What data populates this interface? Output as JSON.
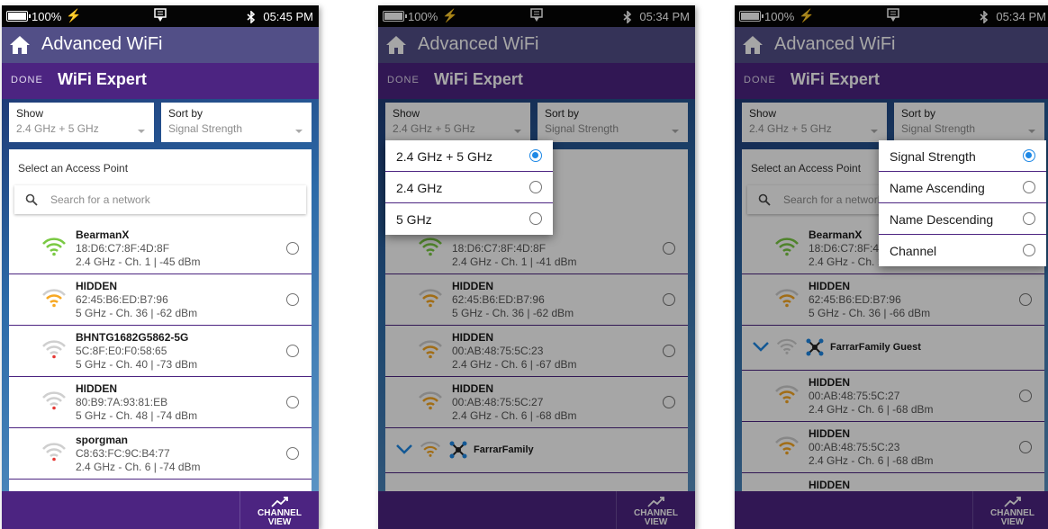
{
  "colors": {
    "header": "#524f87",
    "subheader": "#4c2481",
    "accent": "#1e88e5"
  },
  "panels": [
    {
      "status": {
        "battery": "100%",
        "time": "05:45 PM"
      },
      "app_title": "Advanced WiFi",
      "done": "DONE",
      "expert_title": "WiFi Expert",
      "show": {
        "label": "Show",
        "value": "2.4 GHz + 5 GHz"
      },
      "sort": {
        "label": "Sort by",
        "value": "Signal Strength"
      },
      "list_heading": "Select an Access Point",
      "search_placeholder": "Search for a network",
      "networks": [
        {
          "name": "BearmanX",
          "mac": "18:D6:C7:8F:4D:8F",
          "info": "2.4 GHz - Ch. 1 | -45 dBm",
          "signal": "green"
        },
        {
          "name": "HIDDEN",
          "mac": "62:45:B6:ED:B7:96",
          "info": "5 GHz - Ch. 36 | -62 dBm",
          "signal": "orange"
        },
        {
          "name": "BHNTG1682G5862-5G",
          "mac": "5C:8F:E0:F0:58:65",
          "info": "5 GHz - Ch. 40 | -73 dBm",
          "signal": "red"
        },
        {
          "name": "HIDDEN",
          "mac": "80:B9:7A:93:81:EB",
          "info": "5 GHz - Ch. 48 | -74 dBm",
          "signal": "red"
        },
        {
          "name": "sporgman",
          "mac": "C8:63:FC:9C:B4:77",
          "info": "2.4 GHz - Ch. 6 | -74 dBm",
          "signal": "red"
        }
      ],
      "channel_view": [
        "CHANNEL",
        "VIEW"
      ]
    },
    {
      "status": {
        "battery": "100%",
        "time": "05:34 PM"
      },
      "app_title": "Advanced WiFi",
      "done": "DONE",
      "expert_title": "WiFi Expert",
      "show": {
        "label": "Show",
        "value": "2.4 GHz + 5 GHz"
      },
      "sort": {
        "label": "Sort by",
        "value": "Signal Strength"
      },
      "networks": [
        {
          "name": "",
          "mac": "18:D6:C7:8F:4D:8F",
          "info": "2.4 GHz - Ch. 1 | -41 dBm",
          "signal": "green"
        },
        {
          "name": "HIDDEN",
          "mac": "62:45:B6:ED:B7:96",
          "info": "5 GHz - Ch. 36 | -62 dBm",
          "signal": "orange"
        },
        {
          "name": "HIDDEN",
          "mac": "00:AB:48:75:5C:23",
          "info": "2.4 GHz - Ch. 6 | -67 dBm",
          "signal": "orange"
        },
        {
          "name": "HIDDEN",
          "mac": "00:AB:48:75:5C:27",
          "info": "2.4 GHz - Ch. 6 | -68 dBm",
          "signal": "orange"
        }
      ],
      "group": "FarrarFamily",
      "popup": {
        "options": [
          "2.4 GHz + 5 GHz",
          "2.4 GHz",
          "5 GHz"
        ],
        "selected": 0
      },
      "channel_view": [
        "CHANNEL",
        "VIEW"
      ]
    },
    {
      "status": {
        "battery": "100%",
        "time": "05:34 PM"
      },
      "app_title": "Advanced WiFi",
      "done": "DONE",
      "expert_title": "WiFi Expert",
      "show": {
        "label": "Show",
        "value": "2.4 GHz + 5 GHz"
      },
      "sort": {
        "label": "Sort by",
        "value": "Signal Strength"
      },
      "list_heading": "Select an Access Point",
      "search_placeholder": "Search for a network",
      "networks_a": [
        {
          "name": "BearmanX",
          "mac": "18:D6:C7:8F:4D",
          "info": "2.4 GHz - Ch. 1",
          "signal": "green"
        },
        {
          "name": "HIDDEN",
          "mac": "62:45:B6:ED:B7:96",
          "info": "5 GHz - Ch. 36 | -66 dBm",
          "signal": "orange"
        }
      ],
      "group": "FarrarFamily Guest",
      "networks_b": [
        {
          "name": "HIDDEN",
          "mac": "00:AB:48:75:5C:27",
          "info": "2.4 GHz - Ch. 6 | -68 dBm",
          "signal": "orange"
        },
        {
          "name": "HIDDEN",
          "mac": "00:AB:48:75:5C:23",
          "info": "2.4 GHz - Ch. 6 | -68 dBm",
          "signal": "orange"
        },
        {
          "name": "HIDDEN",
          "mac": "",
          "info": "",
          "signal": ""
        }
      ],
      "popup": {
        "options": [
          "Signal Strength",
          "Name Ascending",
          "Name Descending",
          "Channel"
        ],
        "selected": 0
      },
      "channel_view": [
        "CHANNEL",
        "VIEW"
      ]
    }
  ]
}
